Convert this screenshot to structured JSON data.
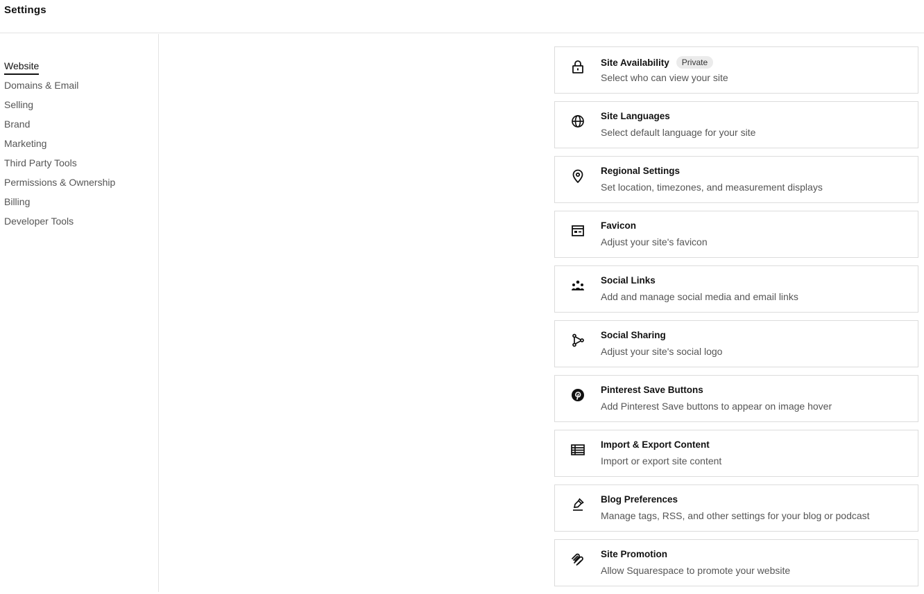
{
  "header": {
    "title": "Settings"
  },
  "sidebar": {
    "items": [
      {
        "label": "Website",
        "active": true
      },
      {
        "label": "Domains & Email"
      },
      {
        "label": "Selling"
      },
      {
        "label": "Brand"
      },
      {
        "label": "Marketing"
      },
      {
        "label": "Third Party Tools"
      },
      {
        "label": "Permissions & Ownership"
      },
      {
        "label": "Billing"
      },
      {
        "label": "Developer Tools"
      }
    ]
  },
  "cards": [
    {
      "icon": "lock-icon",
      "title": "Site Availability",
      "badge": "Private",
      "description": "Select who can view your site"
    },
    {
      "icon": "globe-icon",
      "title": "Site Languages",
      "description": "Select default language for your site"
    },
    {
      "icon": "location-pin-icon",
      "title": "Regional Settings",
      "description": "Set location, timezones, and measurement displays"
    },
    {
      "icon": "favicon-icon",
      "title": "Favicon",
      "description": "Adjust your site's favicon"
    },
    {
      "icon": "people-icon",
      "title": "Social Links",
      "description": "Add and manage social media and email links"
    },
    {
      "icon": "share-icon",
      "title": "Social Sharing",
      "description": "Adjust your site's social logo"
    },
    {
      "icon": "pinterest-icon",
      "title": "Pinterest Save Buttons",
      "description": "Add Pinterest Save buttons to appear on image hover"
    },
    {
      "icon": "table-icon",
      "title": "Import & Export Content",
      "description": "Import or export site content"
    },
    {
      "icon": "pen-icon",
      "title": "Blog Preferences",
      "description": "Manage tags, RSS, and other settings for your blog or podcast"
    },
    {
      "icon": "squarespace-logo-icon",
      "title": "Site Promotion",
      "description": "Allow Squarespace to promote your website"
    }
  ]
}
